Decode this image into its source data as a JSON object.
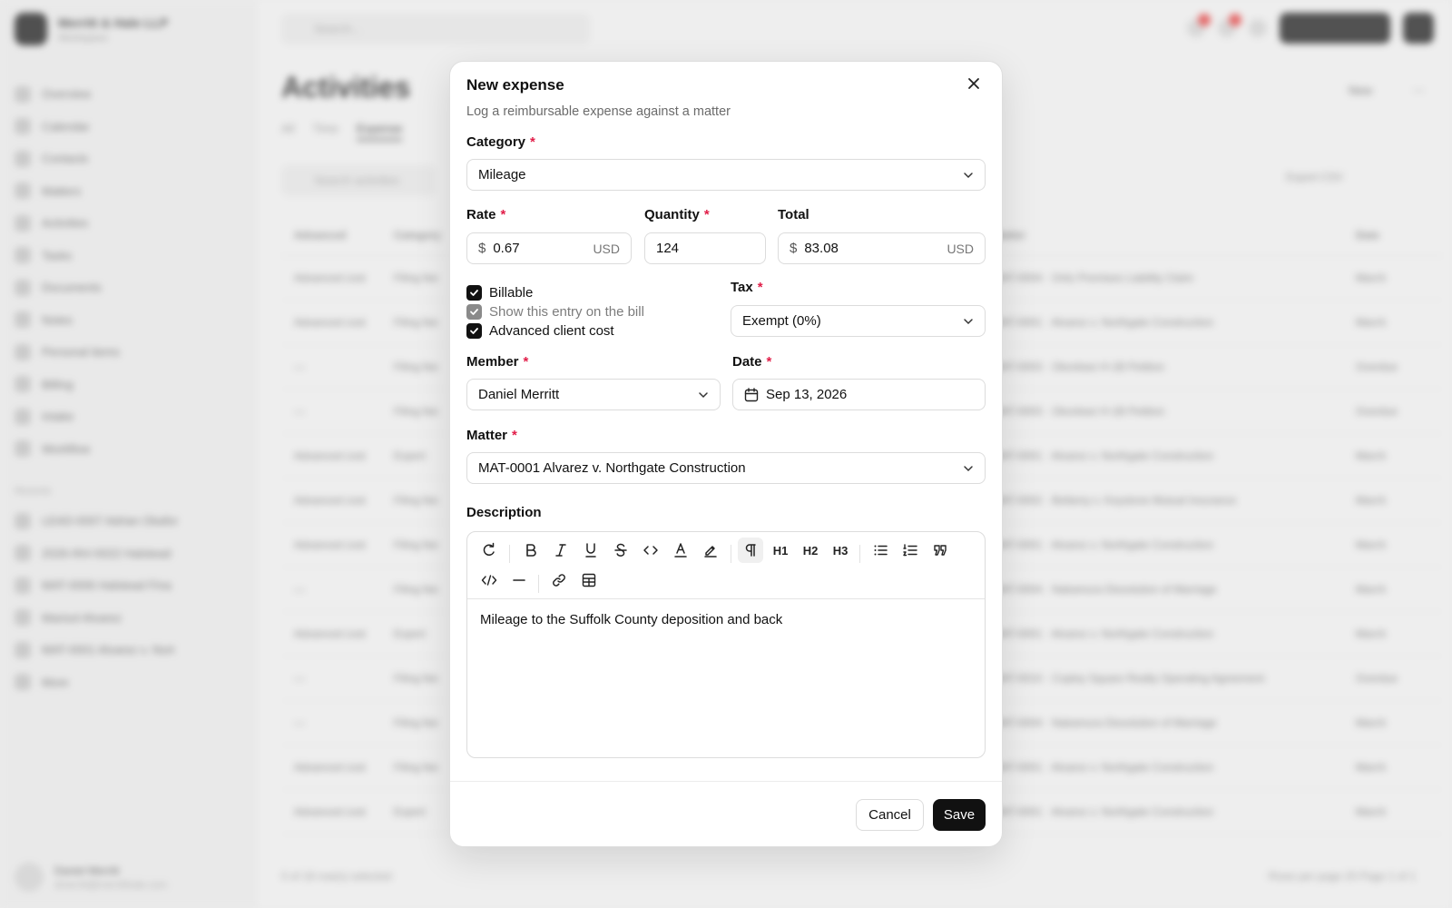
{
  "background": {
    "workspace": {
      "name": "Merritt & Hale LLP",
      "sub": "Workspace"
    },
    "nav": [
      {
        "label": "Overview",
        "count": ""
      },
      {
        "label": "Calendar",
        "count": ""
      },
      {
        "label": "Contacts",
        "count": ""
      },
      {
        "label": "Matters",
        "count": ""
      },
      {
        "label": "Activities",
        "count": ""
      },
      {
        "label": "Tasks",
        "count": ""
      },
      {
        "label": "Documents",
        "count": ""
      },
      {
        "label": "Notes",
        "count": ""
      },
      {
        "label": "Personal items",
        "count": ""
      },
      {
        "label": "Billing",
        "count": ""
      },
      {
        "label": "Intake",
        "count": ""
      },
      {
        "label": "Workflow",
        "count": ""
      }
    ],
    "recent_label": "Recents",
    "recents": [
      {
        "label": "LEAD-0007 Adrian Okafor"
      },
      {
        "label": "2026-INV-0022 Halstead"
      },
      {
        "label": "MAT-0006 Halstead Fina"
      },
      {
        "label": "Marisol Alvarez"
      },
      {
        "label": "MAT-0001 Alvarez v. Nort"
      },
      {
        "label": "More"
      }
    ],
    "user": {
      "name": "Daniel Merritt",
      "email": "dmerritt@merritthale.com"
    },
    "search_placeholder": "Search...",
    "page_title": "Activities",
    "new_label": "New",
    "tabs": [
      "All",
      "Time",
      "Expense"
    ],
    "filter_placeholder": "Search activities",
    "export_label": "Export CSV",
    "columns": [
      "Advanced",
      "Category",
      "Matter",
      "Date"
    ],
    "rows": [
      [
        "Advanced cost",
        "Filing fee",
        "MAT-0004 · Ortiz Premises Liability Claim",
        "March"
      ],
      [
        "Advanced cost",
        "Filing fee",
        "MAT-0001 · Alvarez v. Northgate Construction",
        "March"
      ],
      [
        "—",
        "Filing fee",
        "MAT-0003 · Okonkwo H-1B Petition",
        "Overdue"
      ],
      [
        "—",
        "Filing fee",
        "MAT-0003 · Okonkwo H-1B Petition",
        "Overdue"
      ],
      [
        "Advanced cost",
        "Expert",
        "MAT-0001 · Alvarez v. Northgate Construction",
        "March"
      ],
      [
        "Advanced cost",
        "Filing fee",
        "MAT-0002 · Bellamy v. Keystone Mutual Insurance",
        "March"
      ],
      [
        "Advanced cost",
        "Filing fee",
        "MAT-0001 · Alvarez v. Northgate Construction",
        "March"
      ],
      [
        "—",
        "Filing fee",
        "MAT-0004 · Nakamura Dissolution of Marriage",
        "March"
      ],
      [
        "Advanced cost",
        "Expert",
        "MAT-0001 · Alvarez v. Northgate Construction",
        "March"
      ],
      [
        "—",
        "Filing fee",
        "MAT-0010 · Copley Square Realty Operating Agreement",
        "Overdue"
      ],
      [
        "—",
        "Filing fee",
        "MAT-0004 · Nakamura Dissolution of Marriage",
        "March"
      ],
      [
        "Advanced cost",
        "Filing fee",
        "MAT-0001 · Alvarez v. Northgate Construction",
        "March"
      ],
      [
        "Advanced cost",
        "Expert",
        "MAT-0001 · Alvarez v. Northgate Construction",
        "March"
      ]
    ],
    "footer_left": "0 of 18 row(s) selected",
    "footer_right": "Rows per page  20     Page 1 of 1"
  },
  "modal": {
    "title": "New expense",
    "subtitle": "Log a reimbursable expense against a matter",
    "close_icon": "x-icon",
    "category": {
      "label": "Category",
      "value": "Mileage"
    },
    "rate": {
      "label": "Rate",
      "prefix": "$",
      "value": "0.67",
      "suffix": "USD"
    },
    "quantity": {
      "label": "Quantity",
      "value": "124"
    },
    "total": {
      "label": "Total",
      "prefix": "$",
      "value": "83.08",
      "suffix": "USD"
    },
    "billable": {
      "label": "Billable",
      "checked": true
    },
    "show_on_bill": {
      "label": "Show this entry on the bill",
      "checked": true,
      "disabled": true
    },
    "advanced_cost": {
      "label": "Advanced client cost",
      "checked": true
    },
    "tax": {
      "label": "Tax",
      "value": "Exempt (0%)"
    },
    "member": {
      "label": "Member",
      "value": "Daniel Merritt"
    },
    "date": {
      "label": "Date",
      "value": "Sep 13, 2026"
    },
    "matter": {
      "label": "Matter",
      "value": "MAT-0001 Alvarez v. Northgate Construction"
    },
    "description": {
      "label": "Description",
      "toolbar": {
        "h1": "H1",
        "h2": "H2",
        "h3": "H3"
      },
      "content": "Mileage to the Suffolk County deposition and back"
    },
    "cancel_label": "Cancel",
    "save_label": "Save"
  },
  "colors": {
    "required": "#e11d48",
    "primary": "#111111"
  }
}
